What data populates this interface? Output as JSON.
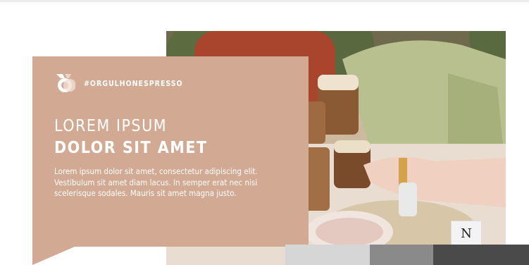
{
  "hero": {
    "hashtag": "#ORGULHONESPRESSO",
    "title_line1": "LOREM IPSUM",
    "title_line2": "DOLOR SIT AMET",
    "body": "Lorem ipsum dolor sit amet, consectetur adipiscing elit. Vestibulum sit amet diam lacus. In semper erat nec nisi scelerisque sodales. Mauris sit amet magna justo.",
    "badge_icon": "medal-icon",
    "brand_logo": "N"
  },
  "colors": {
    "card": "#d2a992",
    "text": "#ffffff"
  }
}
